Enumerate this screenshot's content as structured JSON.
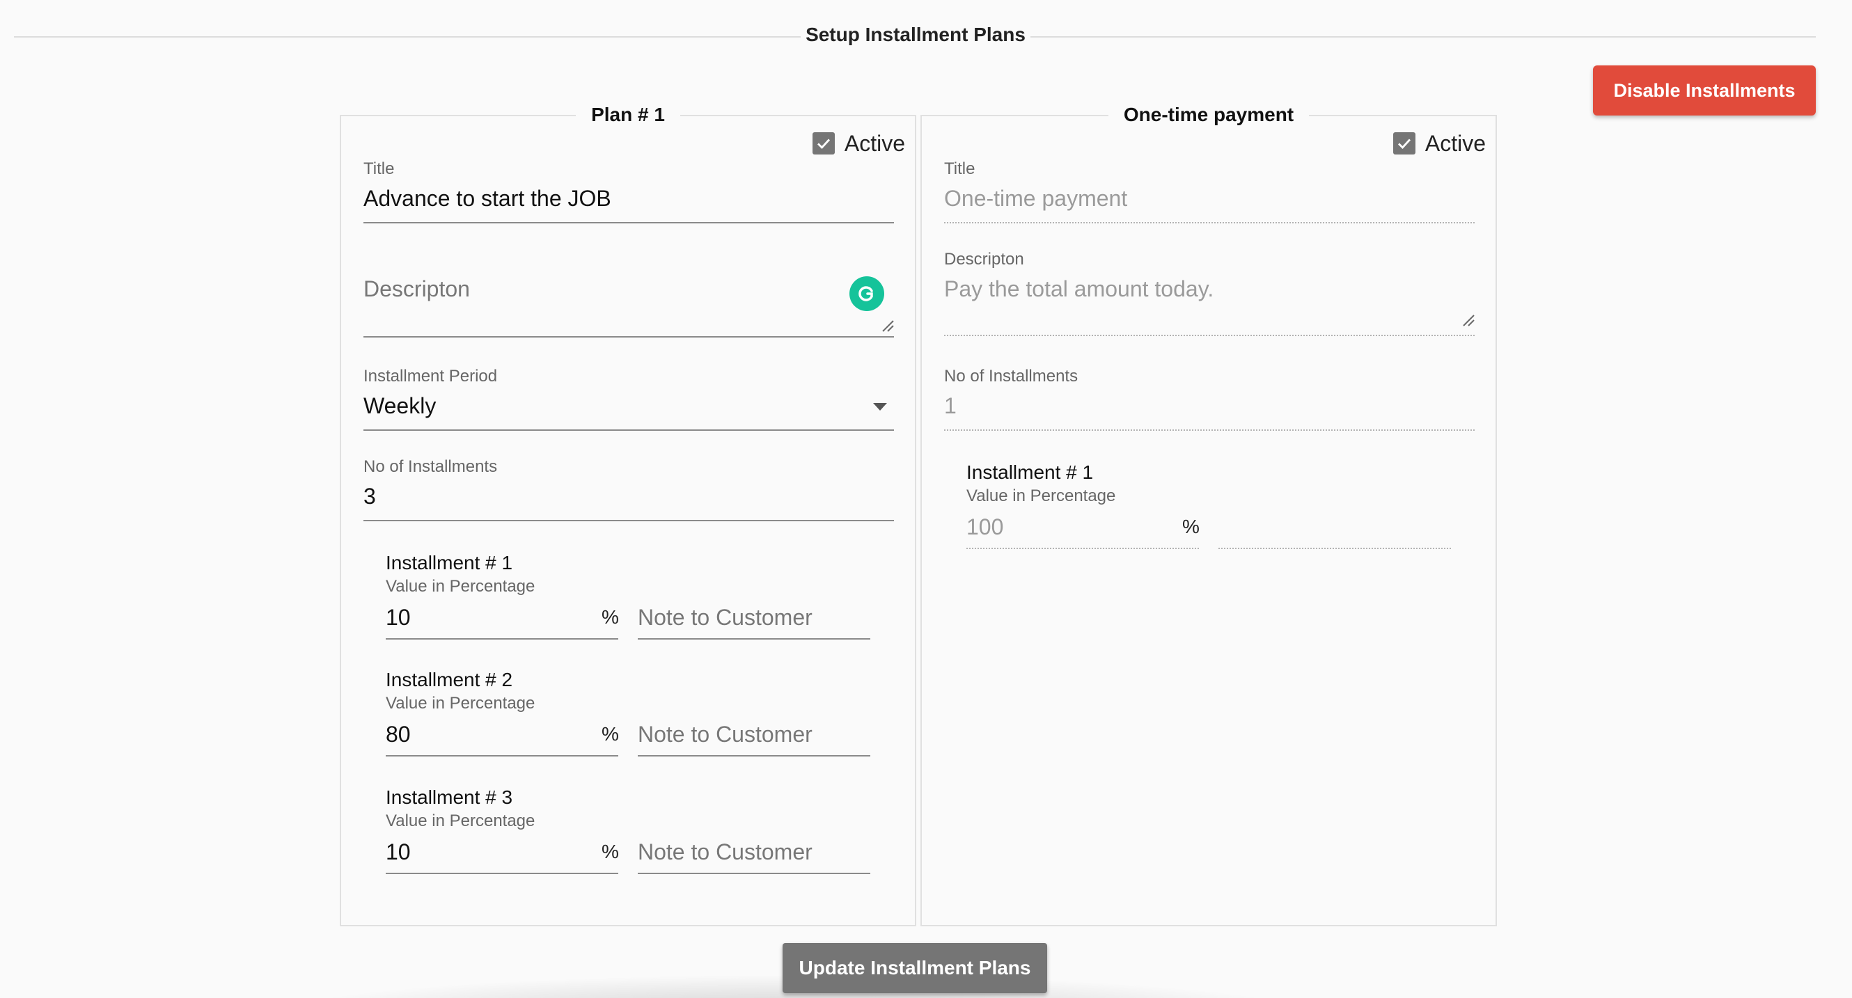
{
  "header": {
    "title": "Setup Installment Plans"
  },
  "actions": {
    "disable_label": "Disable Installments",
    "update_label": "Update Installment Plans"
  },
  "plan1": {
    "legend": "Plan # 1",
    "active_label": "Active",
    "active": true,
    "title_label": "Title",
    "title_value": "Advance to start the JOB",
    "description_placeholder": "Descripton",
    "period_label": "Installment Period",
    "period_value": "Weekly",
    "count_label": "No of Installments",
    "count_value": "3",
    "installments": [
      {
        "title": "Installment # 1",
        "sub": "Value in Percentage",
        "value": "10",
        "pct": "%",
        "note": "Note to Customer"
      },
      {
        "title": "Installment # 2",
        "sub": "Value in Percentage",
        "value": "80",
        "pct": "%",
        "note": "Note to Customer"
      },
      {
        "title": "Installment # 3",
        "sub": "Value in Percentage",
        "value": "10",
        "pct": "%",
        "note": "Note to Customer"
      }
    ]
  },
  "plan2": {
    "legend": "One-time payment",
    "active_label": "Active",
    "active": true,
    "title_label": "Title",
    "title_value": "One-time payment",
    "description_label": "Descripton",
    "description_value": "Pay the total amount today.",
    "count_label": "No of Installments",
    "count_value": "1",
    "installments": [
      {
        "title": "Installment # 1",
        "sub": "Value in Percentage",
        "value": "100",
        "pct": "%"
      }
    ]
  },
  "colors": {
    "danger": "#e14b3b",
    "neutral_button": "#757575",
    "grammarly": "#15c39a"
  }
}
